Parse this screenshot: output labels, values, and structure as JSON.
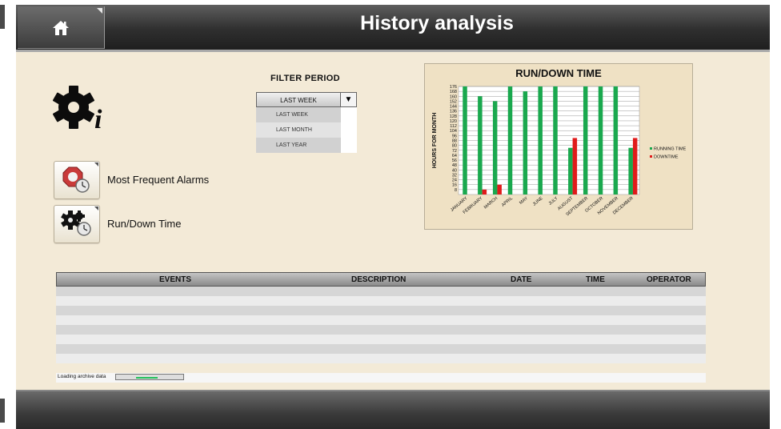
{
  "header": {
    "title": "History analysis",
    "home_icon": "home-icon"
  },
  "sidebar": {
    "buttons": [
      {
        "label": "Most Frequent Alarms",
        "icon": "alarm-clock-icon"
      },
      {
        "label": "Run/Down Time",
        "icon": "gears-clock-icon"
      }
    ]
  },
  "filter": {
    "title": "FILTER PERIOD",
    "selected": "LAST WEEK",
    "options": [
      "LAST WEEK",
      "LAST MONTH",
      "LAST YEAR"
    ]
  },
  "table": {
    "headers": {
      "events": "EVENTS",
      "description": "DESCRIPTION",
      "date": "DATE",
      "time": "TIME",
      "operator": "OPERATOR"
    },
    "row_count": 8
  },
  "status": {
    "loading_text": "Loading archive data",
    "progress": 0.4
  },
  "colors": {
    "running": "#1aa84e",
    "down": "#e01b1b",
    "background": "#f3ead7"
  },
  "chart_data": {
    "type": "bar",
    "title": "RUN/DOWN TIME",
    "ylabel": "HOURS FOR MONTH",
    "xlabel": "",
    "categories": [
      "JANUARY",
      "FEBRUARY",
      "MARCH",
      "APRIL",
      "MAY",
      "JUNE",
      "JULY",
      "AUGUST",
      "SEPTEMBER",
      "OCTOBER",
      "NOVEMBER",
      "DECEMBER"
    ],
    "series": [
      {
        "name": "RUNNING TIME",
        "values": [
          176,
          160,
          152,
          176,
          168,
          176,
          176,
          76,
          176,
          176,
          176,
          76
        ]
      },
      {
        "name": "DOWNTIME",
        "values": [
          0,
          8,
          16,
          0,
          0,
          0,
          0,
          92,
          0,
          0,
          0,
          92
        ]
      }
    ],
    "ylim": [
      0,
      176
    ],
    "yticks": [
      8,
      16,
      24,
      32,
      40,
      48,
      56,
      64,
      72,
      80,
      88,
      96,
      104,
      112,
      120,
      128,
      136,
      144,
      152,
      160,
      168,
      176
    ],
    "grid": true,
    "legend": "right"
  }
}
